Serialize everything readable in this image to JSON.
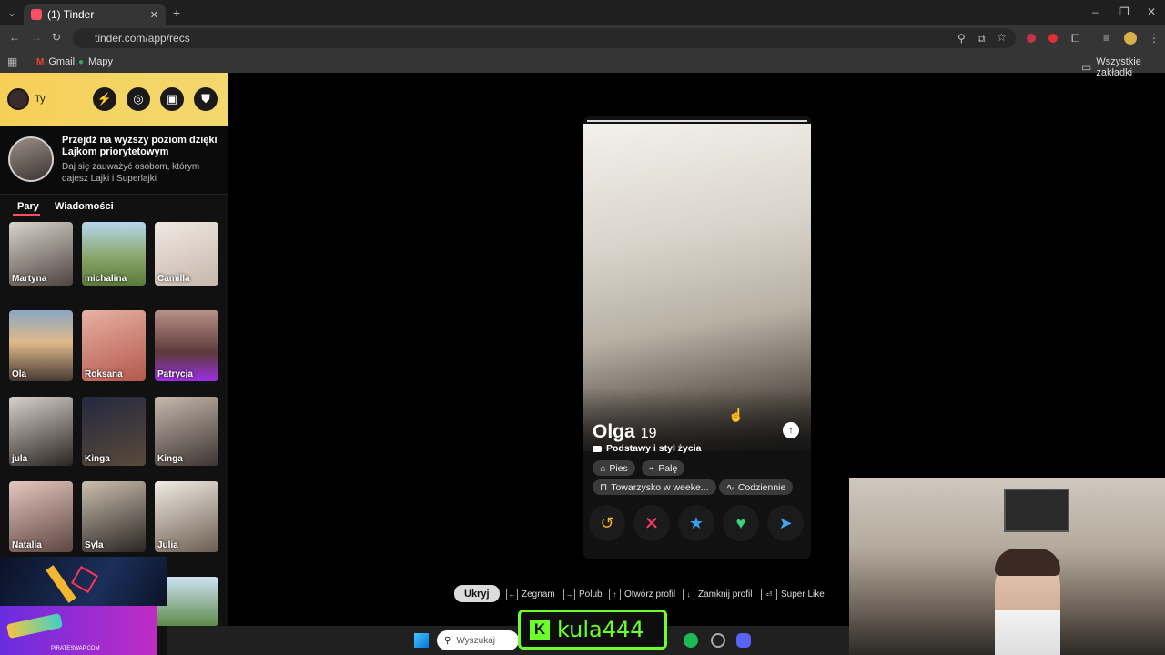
{
  "browser": {
    "tab_title": "(1) Tinder",
    "url": "tinder.com/app/recs",
    "bookmarks": [
      "Gmail",
      "Mapy"
    ],
    "all_bookmarks": "Wszystkie zakładki"
  },
  "sidebar": {
    "profile_label": "Ty",
    "promo": {
      "title": "Przejdź na wyższy poziom dzięki Lajkom priorytetowym",
      "subtitle": "Daj się zauważyć osobom, którym dajesz Lajki i Superlajki"
    },
    "tabs": [
      "Pary",
      "Wiadomości"
    ],
    "matches": [
      "Martyna",
      "michalina",
      "Camilla",
      "Ola",
      "Roksana",
      "Patrycja",
      "jula",
      "Kinga",
      "Kinga",
      "Natalia",
      "Syla",
      "Julia"
    ]
  },
  "card": {
    "name": "Olga",
    "age": "19",
    "section": "Podstawy i styl życia",
    "chips_row1": [
      "Pies",
      "Palę"
    ],
    "chips_row2": [
      "Towarzysko w weeke...",
      "Codziennie"
    ]
  },
  "hints": {
    "hide_button": "Ukryj",
    "items": [
      "Żegnam",
      "Polub",
      "Otwórz profil",
      "Zamknij profil",
      "Super Like"
    ]
  },
  "taskbar": {
    "search_placeholder": "Wyszukaj"
  },
  "overlay": {
    "channel": "kula444",
    "brand": "PIRATESWAP.COM"
  },
  "colors": {
    "tinder": "#fd5068",
    "gold": "#f6cf57",
    "kick_green": "#6cff2a"
  }
}
